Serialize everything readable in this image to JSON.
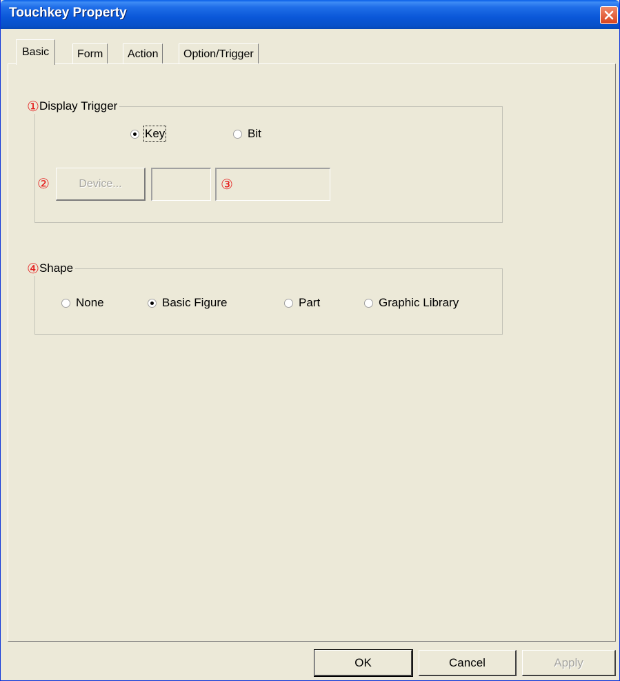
{
  "window": {
    "title": "Touchkey Property"
  },
  "tabs": [
    {
      "label": "Basic",
      "active": true
    },
    {
      "label": "Form",
      "active": false
    },
    {
      "label": "Action",
      "active": false
    },
    {
      "label": "Option/Trigger",
      "active": false
    }
  ],
  "display_trigger": {
    "marker": "①",
    "label": "Display Trigger",
    "options": [
      {
        "label": "Key",
        "selected": true
      },
      {
        "label": "Bit",
        "selected": false
      }
    ],
    "device_marker": "②",
    "device_button": "Device...",
    "device_value": "",
    "device_comment_marker": "③"
  },
  "shape": {
    "marker": "④",
    "label": "Shape",
    "options": [
      {
        "label": "None",
        "selected": false
      },
      {
        "label": "Basic Figure",
        "selected": true
      },
      {
        "label": "Part",
        "selected": false
      },
      {
        "label": "Graphic Library",
        "selected": false
      }
    ]
  },
  "buttons": {
    "ok": "OK",
    "cancel": "Cancel",
    "apply": "Apply"
  },
  "colors": {
    "title_bar": "#0a57d8",
    "close_button": "#d9441e",
    "annotation_marker": "#e41919",
    "dialog_face": "#ece9d8"
  },
  "icons": {
    "close": "close-icon"
  }
}
